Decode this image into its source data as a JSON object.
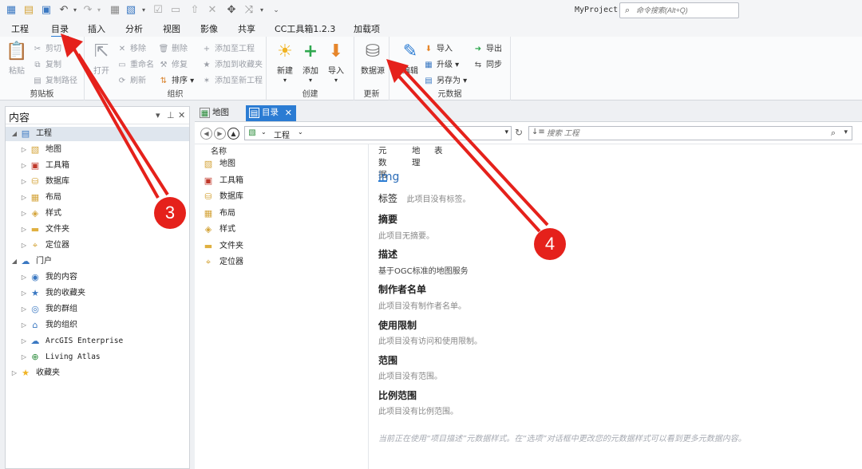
{
  "app": {
    "project_name": "MyProject",
    "command_search_placeholder": "命令搜索(Alt+Q)"
  },
  "menu_tabs": [
    "工程",
    "目录",
    "插入",
    "分析",
    "视图",
    "影像",
    "共享",
    "CC工具箱1.2.3",
    "加载项"
  ],
  "active_menu_tab": "目录",
  "ribbon": {
    "clipboard": {
      "label": "剪贴板",
      "paste": "粘贴",
      "cut": "剪切",
      "copy": "复制",
      "copy_path": "复制路径"
    },
    "organize": {
      "label": "组织",
      "open": "打开",
      "remove": "移除",
      "rename": "重命名",
      "refresh": "刷新",
      "delete": "删除",
      "repair": "修复",
      "sort": "排序",
      "add_to_project": "添加至工程",
      "add_to_favorites": "添加到收藏夹",
      "add_to_new_project": "添加至新工程"
    },
    "create": {
      "label": "创建",
      "new": "新建",
      "add": "添加",
      "import": "导入"
    },
    "update": {
      "label": "更新",
      "datasource": "数据源"
    },
    "metadata": {
      "label": "元数据",
      "edit": "编辑",
      "import": "导入",
      "upgrade": "升级",
      "save_as": "另存为",
      "export": "导出",
      "sync": "同步"
    }
  },
  "left_pane": {
    "title": "内容",
    "items": [
      {
        "label": "工程",
        "level": 0,
        "icon": "project-icon",
        "expanded": true,
        "selected": true
      },
      {
        "label": "地图",
        "level": 1,
        "icon": "map-folder-icon"
      },
      {
        "label": "工具箱",
        "level": 1,
        "icon": "toolbox-folder-icon"
      },
      {
        "label": "数据库",
        "level": 1,
        "icon": "database-folder-icon"
      },
      {
        "label": "布局",
        "level": 1,
        "icon": "layout-folder-icon"
      },
      {
        "label": "样式",
        "level": 1,
        "icon": "style-folder-icon"
      },
      {
        "label": "文件夹",
        "level": 1,
        "icon": "folder-icon"
      },
      {
        "label": "定位器",
        "level": 1,
        "icon": "locator-folder-icon"
      },
      {
        "label": "门户",
        "level": 0,
        "icon": "portal-icon",
        "expanded": true
      },
      {
        "label": "我的内容",
        "level": 1,
        "icon": "my-content-icon"
      },
      {
        "label": "我的收藏夹",
        "level": 1,
        "icon": "my-favorites-icon"
      },
      {
        "label": "我的群组",
        "level": 1,
        "icon": "my-groups-icon"
      },
      {
        "label": "我的组织",
        "level": 1,
        "icon": "my-organization-icon"
      },
      {
        "label": "ArcGIS Enterprise",
        "level": 1,
        "icon": "enterprise-cloud-icon",
        "mono": true
      },
      {
        "label": "Living Atlas",
        "level": 1,
        "icon": "living-atlas-icon",
        "mono": true
      },
      {
        "label": "收藏夹",
        "level": 0,
        "icon": "star-icon"
      }
    ]
  },
  "doc_tabs": [
    {
      "label": "地图",
      "active": false,
      "icon": "map-tab-icon"
    },
    {
      "label": "目录",
      "active": true,
      "icon": "catalog-tab-icon"
    }
  ],
  "catalog": {
    "path": "工程",
    "search_placeholder": "搜索 工程",
    "column_name": "名称",
    "items": [
      "地图",
      "工具箱",
      "数据库",
      "布局",
      "样式",
      "文件夹",
      "定位器"
    ]
  },
  "metadata": {
    "tabs": [
      "元数据",
      "地理",
      "表"
    ],
    "active_tab": "元数据",
    "title": "img",
    "tags_label": "标签",
    "tags_text": "此项目没有标签。",
    "summary_label": "摘要",
    "summary_text": "此项目无摘要。",
    "description_label": "描述",
    "description_text": "基于OGC标准的地图服务",
    "credits_label": "制作者名单",
    "credits_text": "此项目没有制作者名单。",
    "use_limits_label": "使用限制",
    "use_limits_text": "此项目没有访问和使用限制。",
    "extent_label": "范围",
    "extent_text": "此项目没有范围。",
    "scale_label": "比例范围",
    "scale_text": "此项目没有比例范围。",
    "footer": "当前正在使用“项目描述”元数据样式。在“选项”对话框中更改您的元数据样式可以看到更多元数据内容。"
  },
  "annotations": {
    "step3": "3",
    "step4": "4",
    "color": "#e5211b"
  }
}
